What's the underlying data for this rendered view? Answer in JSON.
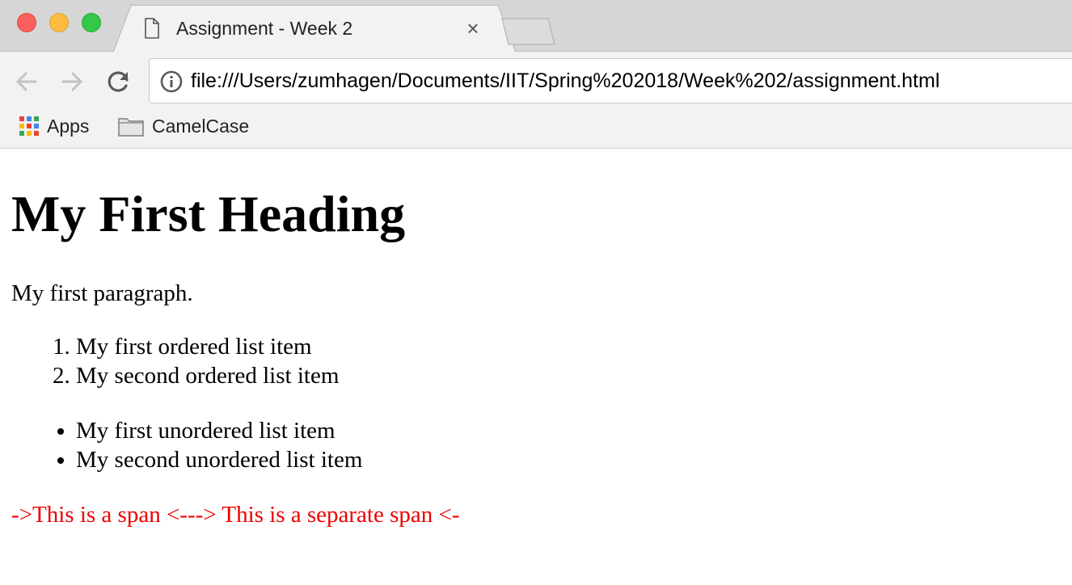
{
  "browser": {
    "tab": {
      "title": "Assignment - Week 2",
      "close_glyph": "×"
    },
    "address_bar": {
      "url": "file:///Users/zumhagen/Documents/IIT/Spring%202018/Week%202/assignment.html"
    },
    "bookmarks": [
      {
        "label": "Apps",
        "icon": "apps-grid-icon"
      },
      {
        "label": "CamelCase",
        "icon": "folder-icon"
      }
    ]
  },
  "page": {
    "heading": "My First Heading",
    "paragraph": "My first paragraph.",
    "ordered_list": [
      "My first ordered list item",
      "My second ordered list item"
    ],
    "unordered_list": [
      "My first unordered list item",
      "My second unordered list item"
    ],
    "spans": [
      "->This is a span <-",
      "--> This is a separate span <-"
    ],
    "span_color": "#ee0000"
  },
  "colors": {
    "traffic_red": "#fc605c",
    "traffic_yellow": "#fdbc40",
    "traffic_green": "#34c84a",
    "apps_icon": [
      "#ea4335",
      "#4285f4",
      "#34a853",
      "#fbbc05",
      "#ea4335",
      "#4285f4",
      "#34a853",
      "#fbbc05",
      "#ea4335"
    ]
  }
}
